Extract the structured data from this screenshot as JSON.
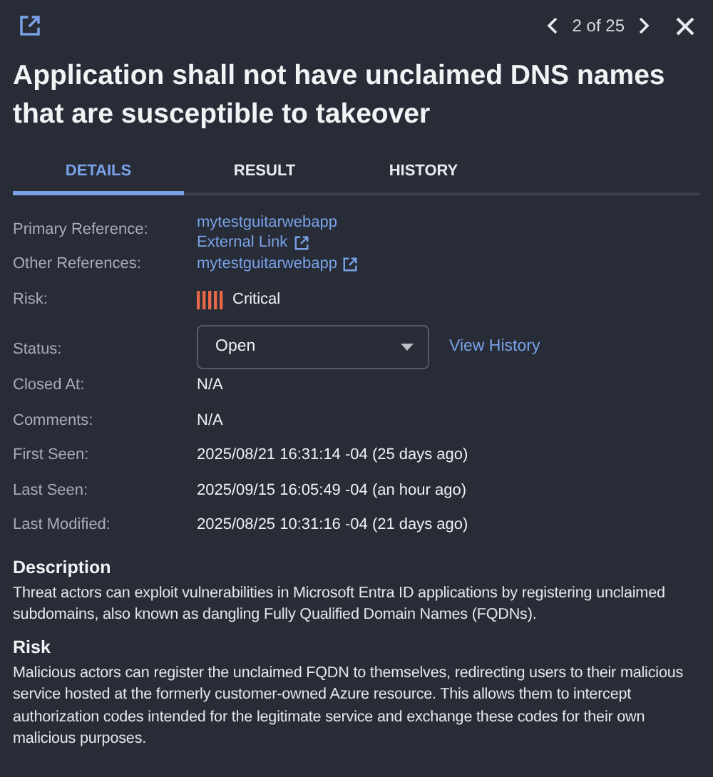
{
  "pager": {
    "position": "2 of 25"
  },
  "title": "Application shall not have unclaimed DNS names that are susceptible to takeover",
  "tabs": [
    {
      "label": "DETAILS",
      "selected": true
    },
    {
      "label": "RESULT",
      "selected": false
    },
    {
      "label": "HISTORY",
      "selected": false
    }
  ],
  "fields": [
    {
      "kind": "links",
      "label": "Primary Reference:",
      "links": [
        {
          "text": "mytestguitarwebapp",
          "external": false
        },
        {
          "text": "External Link",
          "external": true
        }
      ]
    },
    {
      "kind": "links",
      "label": "Other References:",
      "links": [
        {
          "text": "mytestguitarwebapp",
          "external": true
        }
      ]
    },
    {
      "kind": "risk",
      "label": "Risk:",
      "value": "Critical"
    },
    {
      "kind": "select",
      "label": "Status:",
      "value": "Open",
      "link": "View History"
    },
    {
      "kind": "text",
      "label": "Closed At:",
      "value": "N/A"
    },
    {
      "kind": "text",
      "label": "Comments:",
      "value": "N/A"
    },
    {
      "kind": "text",
      "label": "First Seen:",
      "value": "2025/08/21 16:31:14 -04 (25 days ago)"
    },
    {
      "kind": "text",
      "label": "Last Seen:",
      "value": "2025/09/15 16:05:49 -04 (an hour ago)"
    },
    {
      "kind": "text",
      "label": "Last Modified:",
      "value": "2025/08/25 10:31:16 -04 (21 days ago)"
    }
  ],
  "sections": [
    {
      "heading": "Description",
      "body": "Threat actors can exploit vulnerabilities in Microsoft Entra ID applications by registering unclaimed subdomains, also known as dangling Fully Qualified Domain Names (FQDNs)."
    },
    {
      "heading": "Risk",
      "body": "Malicious actors can register the unclaimed FQDN to themselves, redirecting users to their malicious service hosted at the formerly customer-owned Azure resource. This allows them to intercept authorization codes intended for the legitimate service and exchange these codes for their own malicious purposes."
    }
  ]
}
